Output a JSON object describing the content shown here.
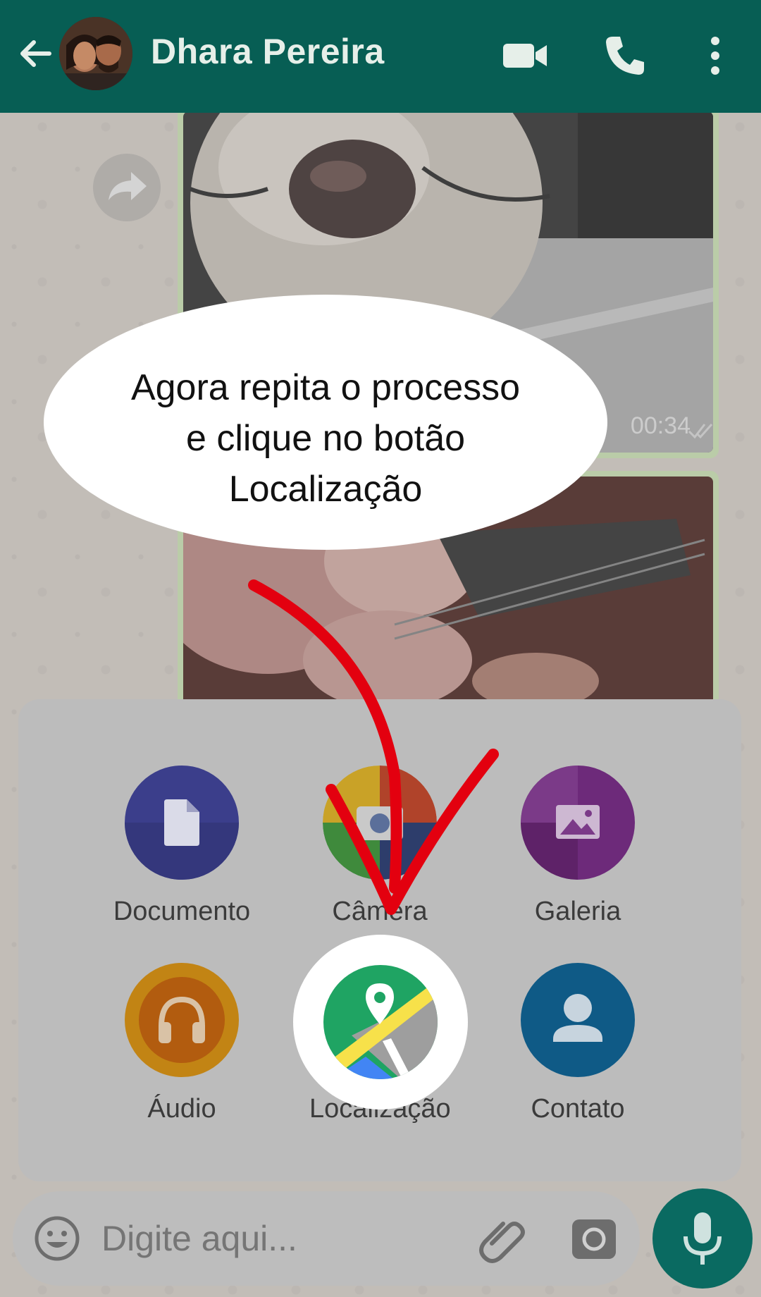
{
  "header": {
    "contact_name": "Dhara Pereira",
    "icons": [
      "back-arrow-icon",
      "video-call-icon",
      "phone-icon",
      "more-options-icon"
    ]
  },
  "chat": {
    "messages": [
      {
        "type": "video",
        "time": "00:34",
        "status_icon": "double-check-icon"
      },
      {
        "type": "video"
      }
    ]
  },
  "attach_menu": {
    "items": [
      {
        "label": "Documento",
        "icon": "document-icon",
        "color": "#3b3e8b"
      },
      {
        "label": "Câmera",
        "icon": "camera-icon",
        "color": "#d23b2f"
      },
      {
        "label": "Galeria",
        "icon": "gallery-icon",
        "color": "#7b2a86"
      },
      {
        "label": "Áudio",
        "icon": "headphones-icon",
        "color": "#e88a11"
      },
      {
        "label": "Localização",
        "icon": "location-icon",
        "color": "#1fa463"
      },
      {
        "label": "Contato",
        "icon": "contact-icon",
        "color": "#1268a6"
      }
    ]
  },
  "composer": {
    "placeholder": "Digite aqui...",
    "icons": [
      "emoji-icon",
      "attach-icon",
      "camera-icon",
      "mic-icon"
    ]
  },
  "tutorial": {
    "callout_line1": "Agora repita o processo",
    "callout_line2": "e clique no botão",
    "callout_line3": "Localização",
    "arrow_color": "#e3000f"
  }
}
